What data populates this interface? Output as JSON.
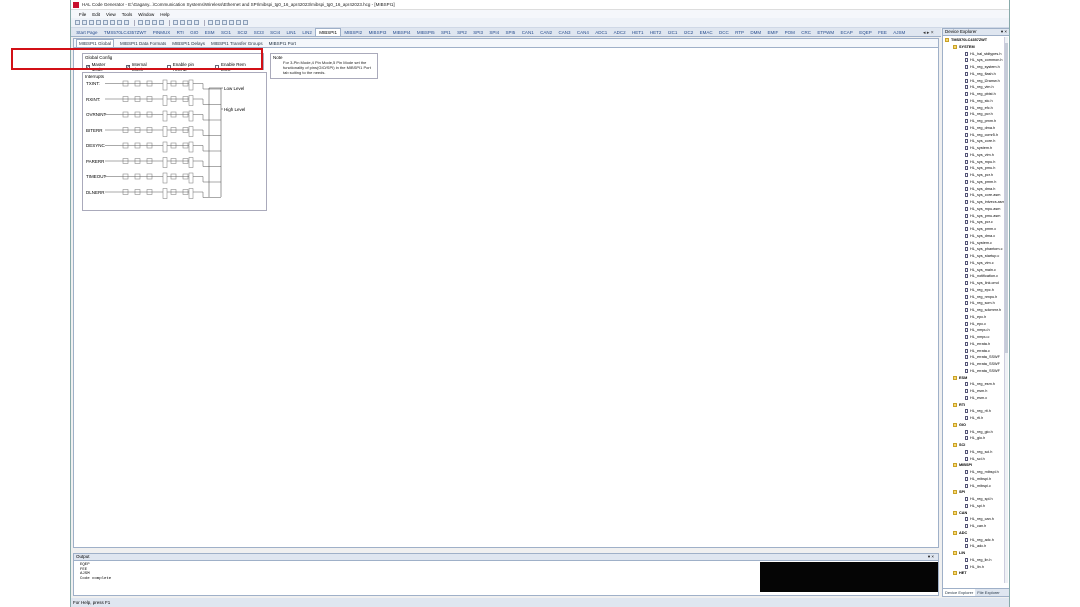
{
  "window": {
    "title": "HALCoGen - HAL Code Generator - E:\\Gagany...\\Communication Systems\\Wireless\\Ethernet and SPI\\mibspi_tg0_16_apr42023\\mibspi_tg0_16_apr42023.hcg - [MIBSPI1]",
    "title_short": "HAL Code Generator - E:\\Gagany...\\Communication Systems\\Wireless\\Ethernet and SPI\\mibspi_tg0_16_apr42023\\mibspi_tg0_16_apr42023.hcg - [MIBSPI1]"
  },
  "menu": [
    "File",
    "Edit",
    "View",
    "Tools",
    "Window",
    "Help"
  ],
  "module_tabs": [
    "Start Page",
    "TMS570LC4357ZWT",
    "PINMUX",
    "RTI",
    "GIO",
    "ESM",
    "SCI1",
    "SCI2",
    "SCI3",
    "SCI4",
    "LIN1",
    "LIN2",
    "MIBSPI1",
    "MIBSPI2",
    "MIBSPI3",
    "MIBSPI4",
    "MIBSPI5",
    "SPI1",
    "SPI2",
    "SPI3",
    "SPI4",
    "SPI5",
    "CAN1",
    "CAN2",
    "CAN3",
    "CAN4",
    "ADC1",
    "ADC2",
    "HET1",
    "HET2",
    "I2C1",
    "I2C2",
    "EMAC",
    "DCC",
    "RTP",
    "DMM",
    "EMIF",
    "POM",
    "CRC",
    "ETPWM",
    "ECAP",
    "EQEP",
    "FEE",
    "AJSM"
  ],
  "active_module_tab": "MIBSPI1",
  "sub_tabs": [
    "MIBSPI1 Global",
    "MIBSPI1 Data Formats",
    "MIBSPI1 Delays",
    "MIBSPI1 Transfer Groups",
    "MIBSPI1 Port"
  ],
  "global_config": {
    "title": "Global Config",
    "options": [
      {
        "label": "Master Mode",
        "checked": true
      },
      {
        "label": "Internal Clock",
        "checked": true
      },
      {
        "label": "Enable pin HIGHZ",
        "checked": false
      },
      {
        "label": "Enable Rem ECC",
        "checked": false
      }
    ]
  },
  "note": {
    "title": "Note",
    "text": "For 3-Pin Mode,4 Pin Mode,5 Pin Mode set the functionality of pins(GIO/SPI) in the MIBSPI1 Port tab suiting to the needs."
  },
  "interrupts": {
    "title": "Interrupts",
    "items": [
      "TXINT:",
      "RXINT:",
      "OVRNINT",
      "BITERR",
      "DESYNC",
      "PARERR",
      "TIMEOUT",
      "DLNERR"
    ],
    "low_level": "Low Level",
    "high_level": "High Level"
  },
  "output": {
    "title": "Output",
    "lines": [
      "EQEP",
      "FEE",
      "AJSM",
      "Code complete"
    ]
  },
  "status": "For Help, press F1",
  "device_explorer": {
    "title": "Device Explorer",
    "root": "TMS570LC4357ZWT",
    "tree": [
      {
        "label": "SYSTEM",
        "group": true
      },
      {
        "label": "HL_hal_stdtypes.h"
      },
      {
        "label": "HL_sys_common.h"
      },
      {
        "label": "HL_reg_system.h"
      },
      {
        "label": "HL_reg_flash.h"
      },
      {
        "label": "HL_reg_l2ramw.h"
      },
      {
        "label": "HL_reg_vim.h"
      },
      {
        "label": "HL_reg_pbist.h"
      },
      {
        "label": "HL_reg_stc.h"
      },
      {
        "label": "HL_reg_efc.h"
      },
      {
        "label": "HL_reg_pcr.h"
      },
      {
        "label": "HL_reg_pmm.h"
      },
      {
        "label": "HL_reg_dma.h"
      },
      {
        "label": "HL_reg_ccmr5.h"
      },
      {
        "label": "HL_sys_core.h"
      },
      {
        "label": "HL_system.h"
      },
      {
        "label": "HL_sys_vim.h"
      },
      {
        "label": "HL_sys_mpu.h"
      },
      {
        "label": "HL_sys_pmu.h"
      },
      {
        "label": "HL_sys_pcr.h"
      },
      {
        "label": "HL_sys_pmm.h"
      },
      {
        "label": "HL_sys_dma.h"
      },
      {
        "label": "HL_sys_core.asm"
      },
      {
        "label": "HL_sys_intvecs.asm"
      },
      {
        "label": "HL_sys_mpu.asm"
      },
      {
        "label": "HL_sys_pmu.asm"
      },
      {
        "label": "HL_sys_pcr.c"
      },
      {
        "label": "HL_sys_pmm.c"
      },
      {
        "label": "HL_sys_dma.c"
      },
      {
        "label": "HL_system.c"
      },
      {
        "label": "HL_sys_phantom.c"
      },
      {
        "label": "HL_sys_startup.c"
      },
      {
        "label": "HL_sys_vim.c"
      },
      {
        "label": "HL_sys_main.c"
      },
      {
        "label": "HL_notification.c"
      },
      {
        "label": "HL_sys_link.cmd"
      },
      {
        "label": "HL_reg_epc.h"
      },
      {
        "label": "HL_reg_nmpu.h"
      },
      {
        "label": "HL_reg_scm.h"
      },
      {
        "label": "HL_reg_sdcmmr.h"
      },
      {
        "label": "HL_epc.h"
      },
      {
        "label": "HL_epc.c"
      },
      {
        "label": "HL_nmpu.h"
      },
      {
        "label": "HL_nmpu.c"
      },
      {
        "label": "HL_errata.h"
      },
      {
        "label": "HL_errata.c"
      },
      {
        "label": "HL_errata_SSWF"
      },
      {
        "label": "HL_errata_SSWF"
      },
      {
        "label": "HL_errata_SSWF"
      },
      {
        "label": "ESM",
        "group": true
      },
      {
        "label": "HL_reg_esm.h"
      },
      {
        "label": "HL_esm.h"
      },
      {
        "label": "HL_esm.c"
      },
      {
        "label": "RTI",
        "group": true
      },
      {
        "label": "HL_reg_rti.h"
      },
      {
        "label": "HL_rti.h"
      },
      {
        "label": "GIO",
        "group": true
      },
      {
        "label": "HL_reg_gio.h"
      },
      {
        "label": "HL_gio.h"
      },
      {
        "label": "SCI",
        "group": true
      },
      {
        "label": "HL_reg_sci.h"
      },
      {
        "label": "HL_sci.h"
      },
      {
        "label": "MIBSPI",
        "group": true
      },
      {
        "label": "HL_reg_mibspi.h"
      },
      {
        "label": "HL_mibspi.h"
      },
      {
        "label": "HL_mibspi.c"
      },
      {
        "label": "SPI",
        "group": true
      },
      {
        "label": "HL_reg_spi.h"
      },
      {
        "label": "HL_spi.h"
      },
      {
        "label": "CAN",
        "group": true
      },
      {
        "label": "HL_reg_can.h"
      },
      {
        "label": "HL_can.h"
      },
      {
        "label": "ADC",
        "group": true
      },
      {
        "label": "HL_reg_adc.h"
      },
      {
        "label": "HL_adc.h"
      },
      {
        "label": "LIN",
        "group": true
      },
      {
        "label": "HL_reg_lin.h"
      },
      {
        "label": "HL_lin.h"
      },
      {
        "label": "HET",
        "group": true
      }
    ],
    "tabs": [
      "Device Explorer",
      "File Explorer"
    ]
  },
  "colors": {
    "highlight_box": "#d21016",
    "output_redaction": "#050505"
  }
}
